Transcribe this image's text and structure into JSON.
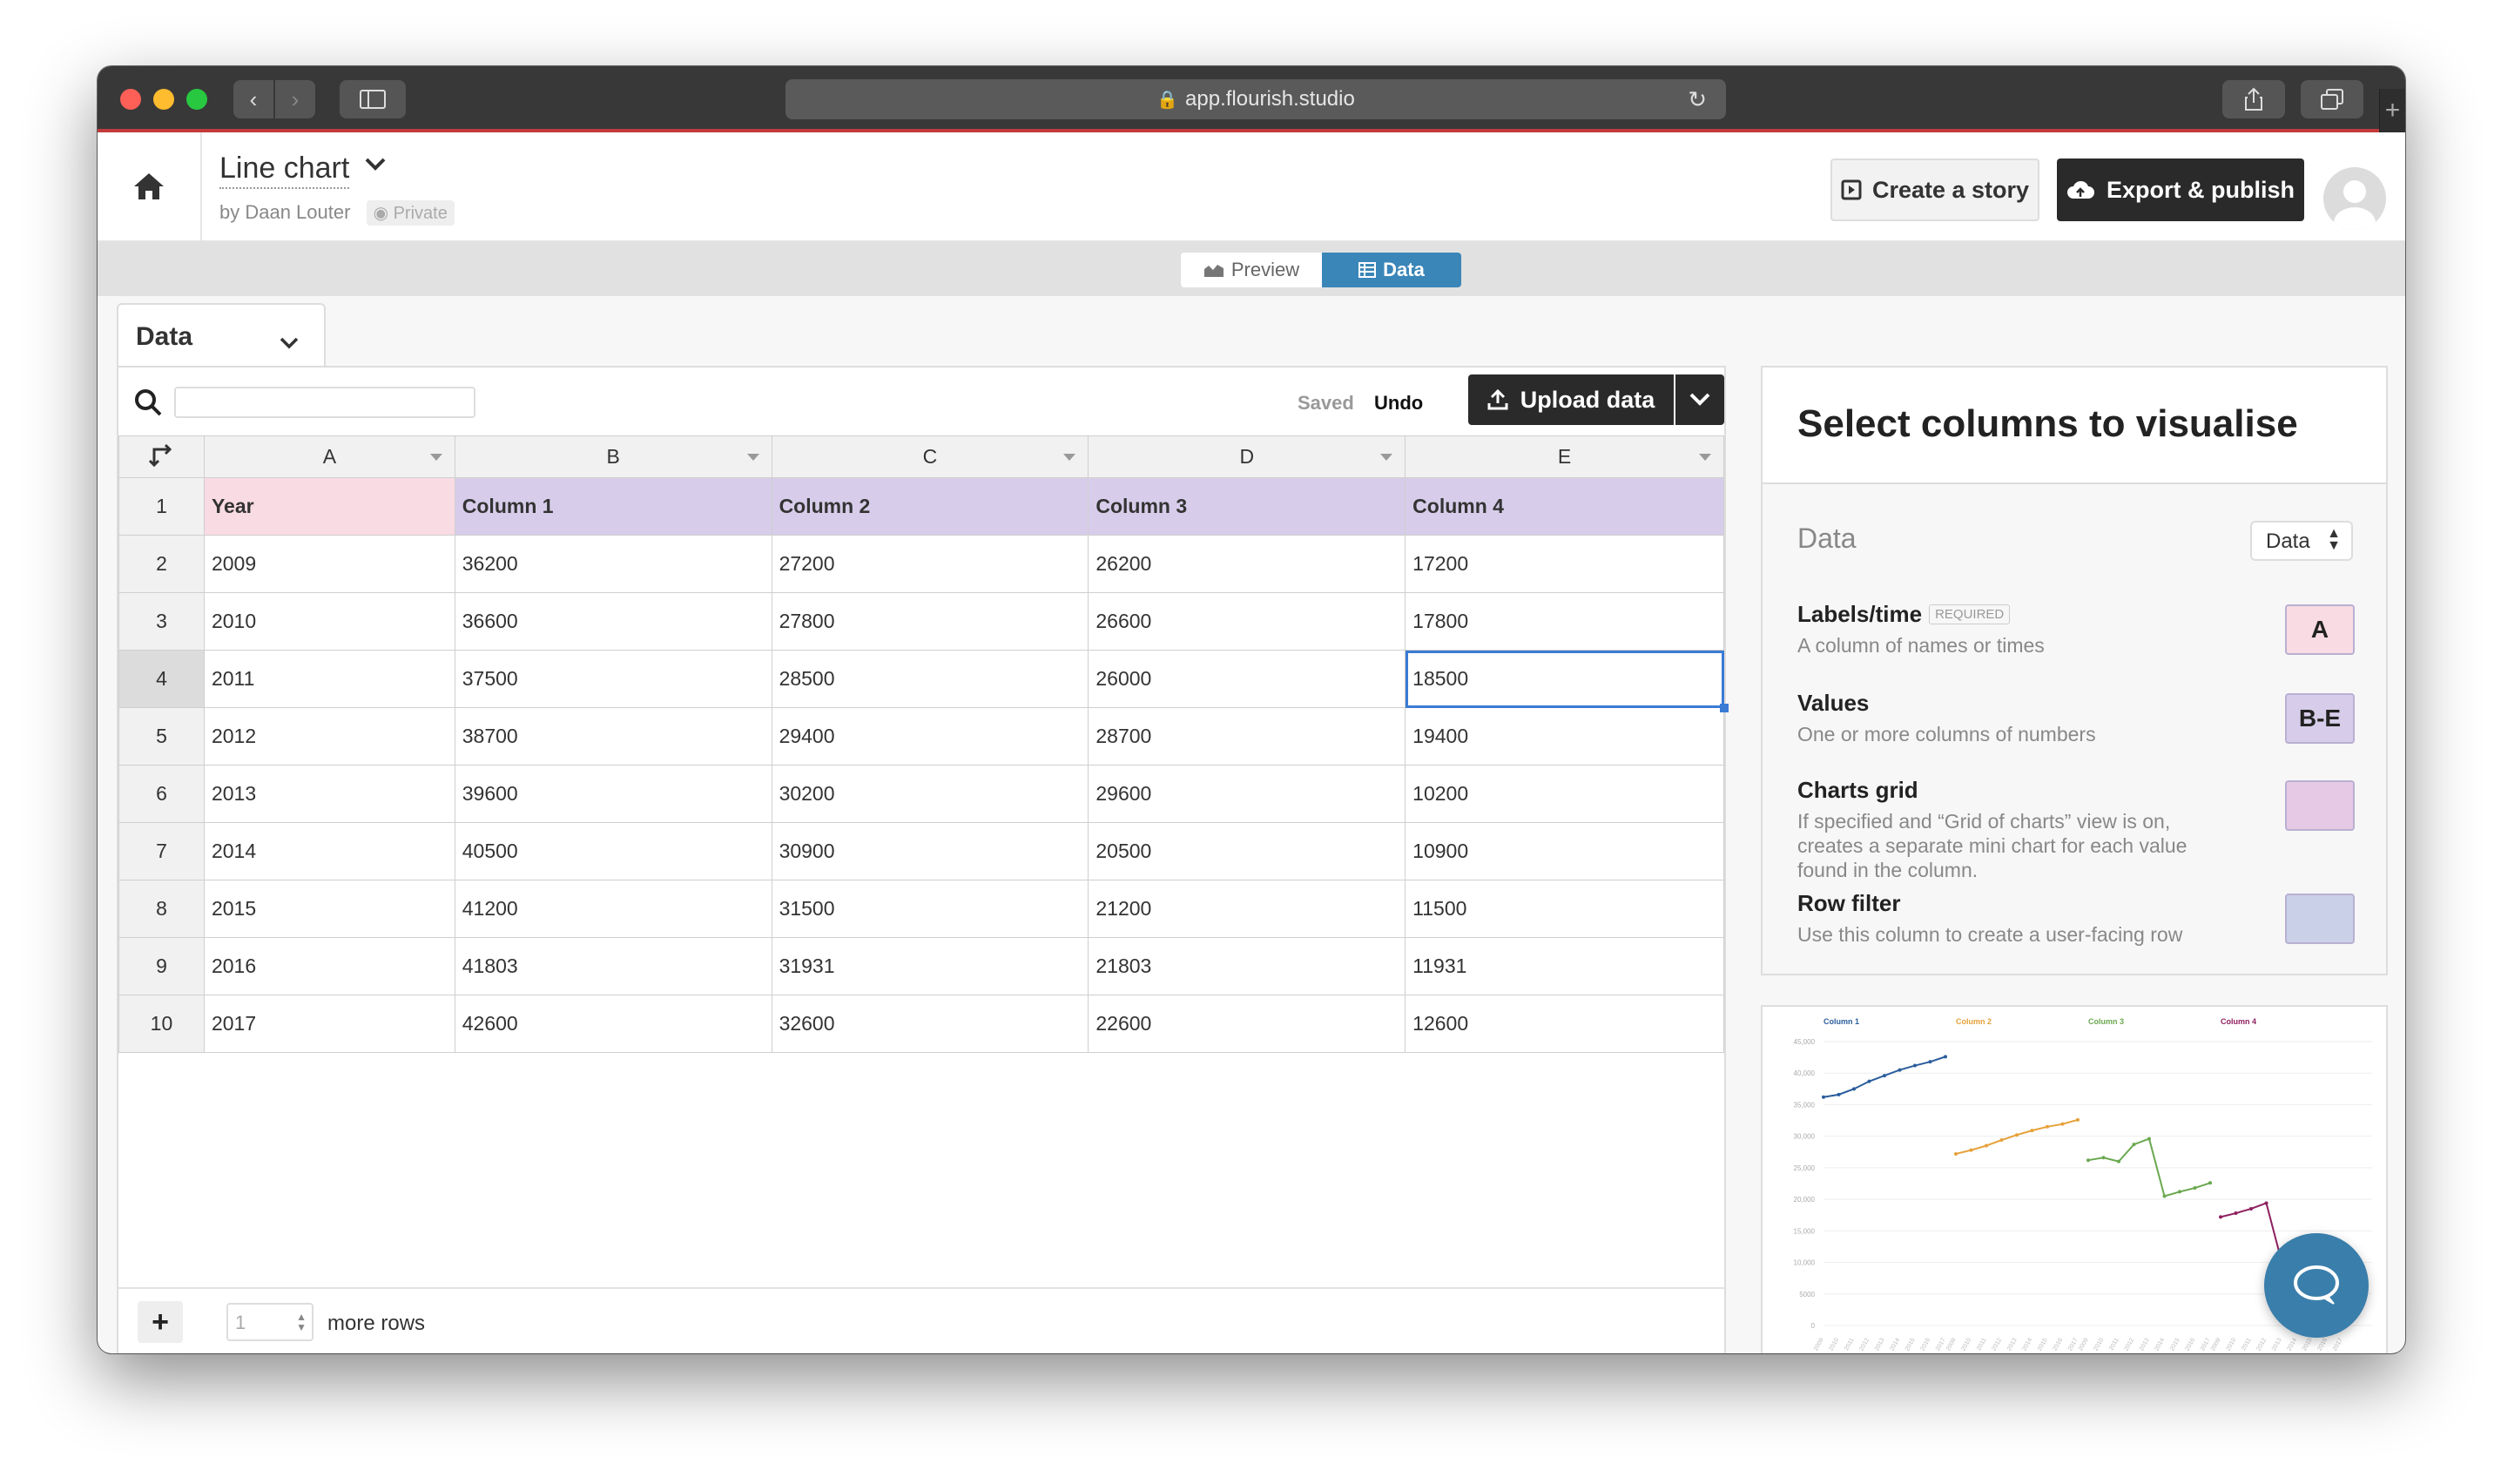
{
  "browser": {
    "url": "app.flourish.studio"
  },
  "header": {
    "title": "Line chart",
    "byline": "by Daan Louter",
    "private_label": "Private",
    "story_button": "Create a story",
    "export_button": "Export & publish"
  },
  "modes": {
    "preview": "Preview",
    "data": "Data"
  },
  "sheet": {
    "tab_label": "Data",
    "saved": "Saved",
    "undo": "Undo",
    "upload_button": "Upload data",
    "search_value": ""
  },
  "grid": {
    "columns": [
      "A",
      "B",
      "C",
      "D",
      "E"
    ],
    "header_row": [
      "Year",
      "Column 1",
      "Column 2",
      "Column 3",
      "Column 4"
    ],
    "rows": [
      [
        "2009",
        "36200",
        "27200",
        "26200",
        "17200"
      ],
      [
        "2010",
        "36600",
        "27800",
        "26600",
        "17800"
      ],
      [
        "2011",
        "37500",
        "28500",
        "26000",
        "18500"
      ],
      [
        "2012",
        "38700",
        "29400",
        "28700",
        "19400"
      ],
      [
        "2013",
        "39600",
        "30200",
        "29600",
        "10200"
      ],
      [
        "2014",
        "40500",
        "30900",
        "20500",
        "10900"
      ],
      [
        "2015",
        "41200",
        "31500",
        "21200",
        "11500"
      ],
      [
        "2016",
        "41803",
        "31931",
        "21803",
        "11931"
      ],
      [
        "2017",
        "42600",
        "32600",
        "22600",
        "12600"
      ]
    ],
    "selected_row": 4,
    "selected_col": 4
  },
  "footer": {
    "add_rows_value": "1",
    "more_rows_label": "more rows"
  },
  "select_panel": {
    "title": "Select columns to visualise",
    "dataset_label": "Data",
    "dataset_value": "Data",
    "bindings": [
      {
        "name": "Labels/time",
        "required": "REQUIRED",
        "desc": "A column of names or times",
        "chip": "A",
        "color": "#f9dbe3"
      },
      {
        "name": "Values",
        "required": "",
        "desc": "One or more columns of numbers",
        "chip": "B-E",
        "color": "#d7cdea"
      },
      {
        "name": "Charts grid",
        "required": "",
        "desc": "If specified and “Grid of charts” view is on, creates a separate mini chart for each value found in the column.",
        "chip": "",
        "color": "#e6c9e4"
      },
      {
        "name": "Row filter",
        "required": "",
        "desc": "Use this column to create a user-facing row",
        "chip": "",
        "color": "#c9d0e8"
      }
    ]
  },
  "colors": {
    "accent": "#3a86b8",
    "labels_col": "#f9dbe3",
    "values_col": "#d7cdea",
    "series": [
      "#2a5d9c",
      "#e6a13a",
      "#6aa84f",
      "#8e1f5f"
    ]
  },
  "chart_data": {
    "type": "line",
    "x": [
      "2009",
      "2010",
      "2011",
      "2012",
      "2013",
      "2014",
      "2015",
      "2016",
      "2017"
    ],
    "series": [
      {
        "name": "Column 1",
        "values": [
          36200,
          36600,
          37500,
          38700,
          39600,
          40500,
          41200,
          41803,
          42600
        ]
      },
      {
        "name": "Column 2",
        "values": [
          27200,
          27800,
          28500,
          29400,
          30200,
          30900,
          31500,
          31931,
          32600
        ]
      },
      {
        "name": "Column 3",
        "values": [
          26200,
          26600,
          26000,
          28700,
          29600,
          20500,
          21200,
          21803,
          22600
        ]
      },
      {
        "name": "Column 4",
        "values": [
          17200,
          17800,
          18500,
          19400,
          10200,
          10900,
          11500,
          11931,
          12600
        ]
      }
    ],
    "ylim": [
      0,
      45000
    ],
    "yticks": [
      "45,000",
      "40,000",
      "35,000",
      "30,000",
      "25,000",
      "20,000",
      "15,000",
      "10,000",
      "5000",
      "0"
    ],
    "grid": true
  }
}
